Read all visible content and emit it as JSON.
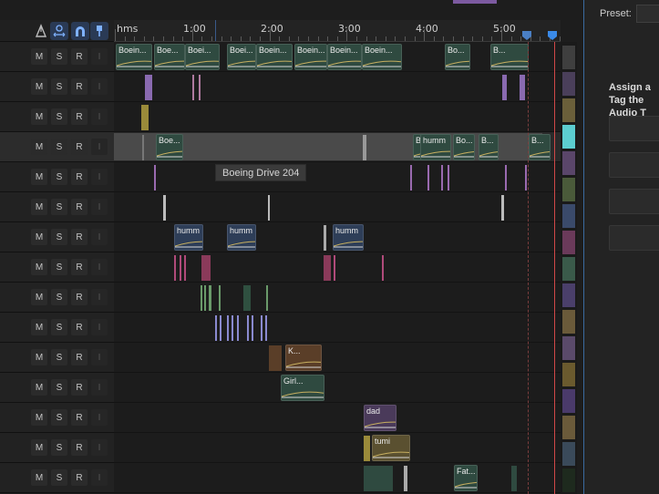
{
  "ruler": {
    "labels": [
      "hms",
      "1:00",
      "2:00",
      "3:00",
      "4:00",
      "5:00"
    ]
  },
  "toolbar": {
    "tools": [
      "snap-tool-icon",
      "ripple-tool-icon",
      "magnet-icon",
      "marker-pin-icon"
    ]
  },
  "track_buttons": [
    "M",
    "S",
    "R",
    "I"
  ],
  "tooltip": "Boeing Drive 204",
  "right_panel": {
    "preset_label": "Preset:",
    "assign_text": "Assign a Tag the Audio T"
  },
  "colors": {
    "accent": "#3a6aa0",
    "playhead": "#d04848",
    "clip_green": "#2f4a40",
    "clip_purple": "#4a3a5a",
    "clip_olive": "#5a5030",
    "clip_blue": "#2e3e58",
    "clip_brown": "#5a3e28"
  },
  "tracks": [
    {
      "clips": [
        "Boein...",
        "Boe...",
        "Boei...",
        "Boei...",
        "Boein...",
        "Boein...",
        "Boein...",
        "Boein...",
        "Bo...",
        "B..."
      ]
    },
    {
      "clips": []
    },
    {
      "clips": []
    },
    {
      "clips": [
        "Boe...",
        "B...",
        "humm",
        "Bo...",
        "B...",
        "B..."
      ]
    },
    {
      "clips": []
    },
    {
      "clips": []
    },
    {
      "clips": [
        "humm",
        "humm",
        "humm"
      ]
    },
    {
      "clips": []
    },
    {
      "clips": []
    },
    {
      "clips": []
    },
    {
      "clips": [
        "K..."
      ]
    },
    {
      "clips": [
        "Girl..."
      ]
    },
    {
      "clips": [
        "dad"
      ]
    },
    {
      "clips": [
        "tumi"
      ]
    },
    {
      "clips": [
        "Fat..."
      ]
    }
  ],
  "swatches": [
    "#3f3f3f",
    "#4a3f5a",
    "#6a5f3a",
    "#5ccdd0",
    "#5a466a",
    "#4a5a3a",
    "#3a4a6a",
    "#6a3a5a",
    "#3a5a4a",
    "#4a3f6a",
    "#6a5a3a",
    "#5a4a6a",
    "#6a5a2e",
    "#4a3a6a",
    "#6a5a3a",
    "#3a4a5a",
    "#1e2a1e"
  ]
}
